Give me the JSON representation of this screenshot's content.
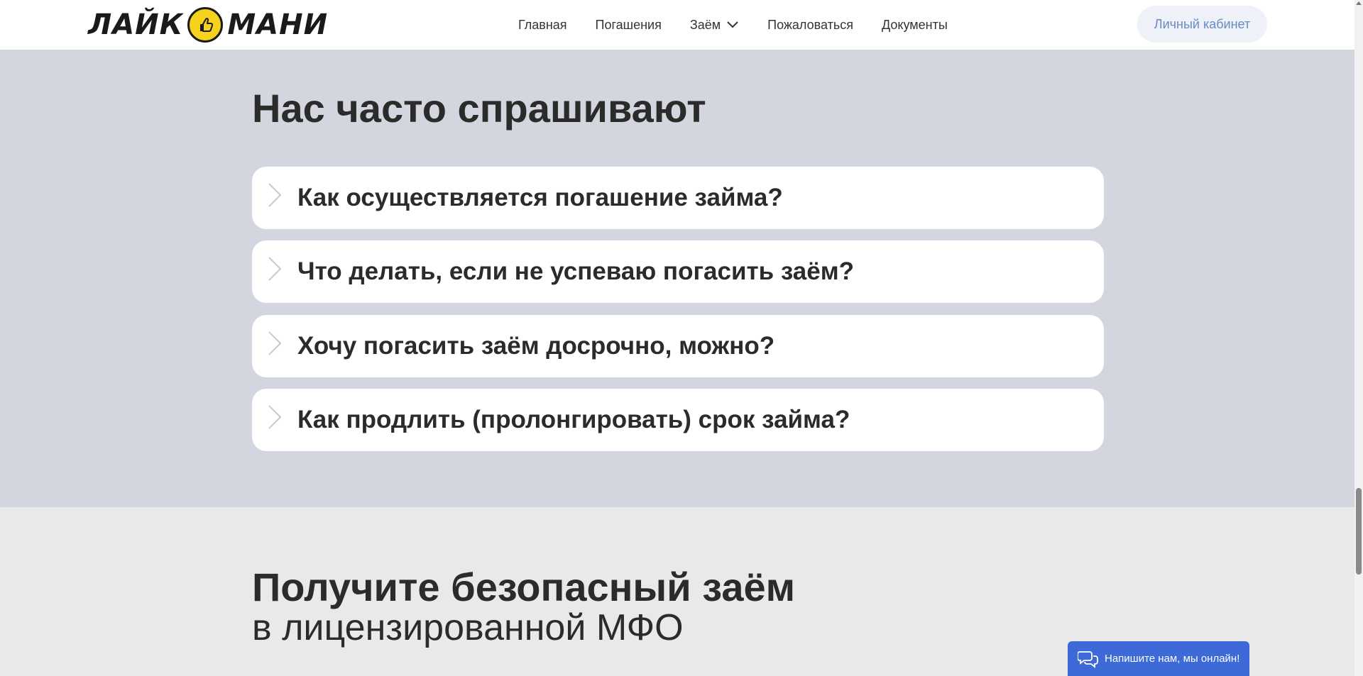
{
  "header": {
    "logo_left": "ЛАЙК",
    "logo_right": "МАНИ",
    "nav": [
      {
        "label": "Главная"
      },
      {
        "label": "Погашения"
      },
      {
        "label": "Заём"
      },
      {
        "label": "Пожаловаться"
      },
      {
        "label": "Документы"
      }
    ],
    "cabinet_label": "Личный кабинет"
  },
  "faq": {
    "title": "Нас часто спрашивают",
    "items": [
      {
        "question": "Как осуществляется погашение займа?"
      },
      {
        "question": "Что делать, если не успеваю погасить заём?"
      },
      {
        "question": "Хочу погасить заём досрочно, можно?"
      },
      {
        "question": "Как продлить (пролонгировать) срок займа?"
      }
    ]
  },
  "promo": {
    "title": "Получите безопасный заём",
    "subtitle": "в лицензированной МФО"
  },
  "chat": {
    "label": "Напишите нам, мы онлайн!"
  },
  "colors": {
    "faq_bg": "#d3d6de",
    "page_bg": "#e9e9ea",
    "chat_bg": "#3d6ad6",
    "cabinet_text": "#6a8bc2",
    "coin": "#f7d21c"
  }
}
